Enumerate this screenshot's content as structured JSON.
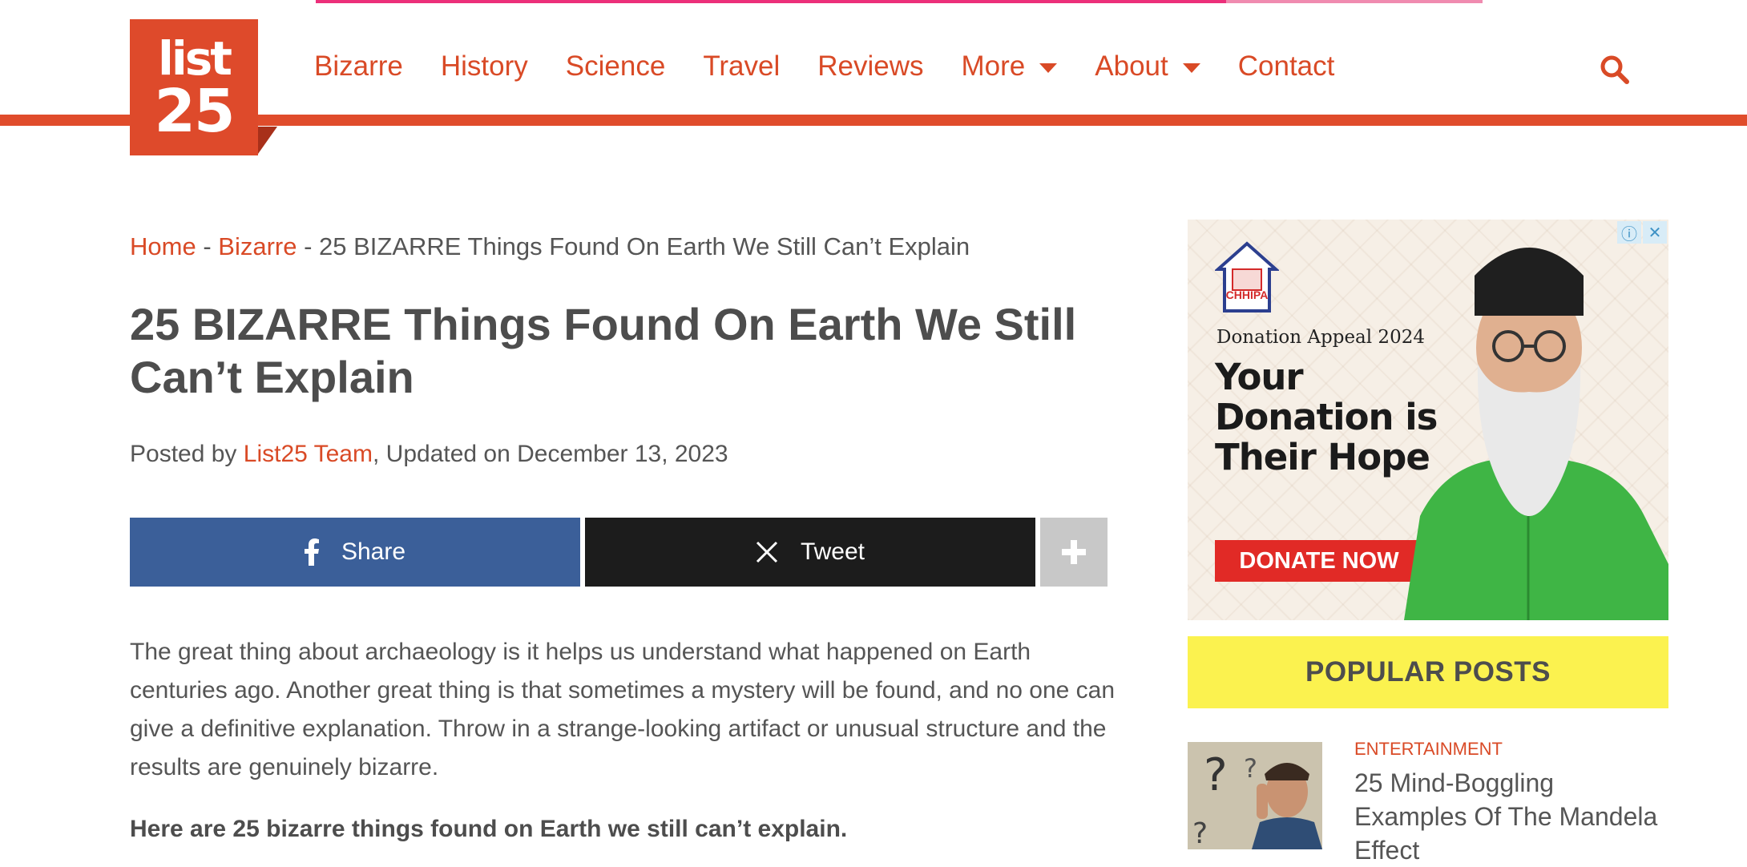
{
  "site": {
    "logo_top": "list",
    "logo_number": "25",
    "reading_progress": 0.78,
    "colors": {
      "brand": "#de4a2b",
      "progress": "#ec2f7a",
      "facebook": "#3b5f99",
      "x": "#1c1c1c",
      "highlight": "#fbf24f"
    }
  },
  "nav": {
    "items": [
      {
        "label": "Bizarre"
      },
      {
        "label": "History"
      },
      {
        "label": "Science"
      },
      {
        "label": "Travel"
      },
      {
        "label": "Reviews"
      },
      {
        "label": "More",
        "dropdown": true
      },
      {
        "label": "About",
        "dropdown": true
      },
      {
        "label": "Contact"
      }
    ],
    "search_icon": "search-icon"
  },
  "breadcrumb": {
    "home": "Home",
    "sep1": " - ",
    "category": "Bizarre",
    "sep2": " - ",
    "current": "25 BIZARRE Things Found On Earth We Still Can’t Explain"
  },
  "article": {
    "title": "25 BIZARRE Things Found On Earth We Still Can’t Explain",
    "byline_prefix": "Posted by ",
    "author": "List25 Team",
    "byline_suffix": ", Updated on December 13, 2023",
    "intro": "The great thing about archaeology is it helps us understand what happened on Earth centuries ago. Another great thing is that sometimes a mystery will be found, and no one can give a definitive explanation. Throw in a strange-looking artifact or unusual structure and the results are genuinely bizarre.",
    "lead": "Here are 25 bizarre things found on Earth we still can’t explain."
  },
  "share": {
    "facebook_label": "Share",
    "x_label": "Tweet",
    "more_icon": "plus-icon"
  },
  "ad": {
    "logo_text": "CHHIPA",
    "appeal": "Donation Appeal 2024",
    "headline": "Your Donation is Their Hope",
    "button": "DONATE NOW",
    "info_symbol": "ⓘ",
    "close_symbol": "✕"
  },
  "sidebar": {
    "popular_title": "POPULAR POSTS",
    "posts": [
      {
        "category": "ENTERTAINMENT",
        "title": "25 Mind-Boggling Examples Of The Mandela Effect"
      }
    ]
  }
}
